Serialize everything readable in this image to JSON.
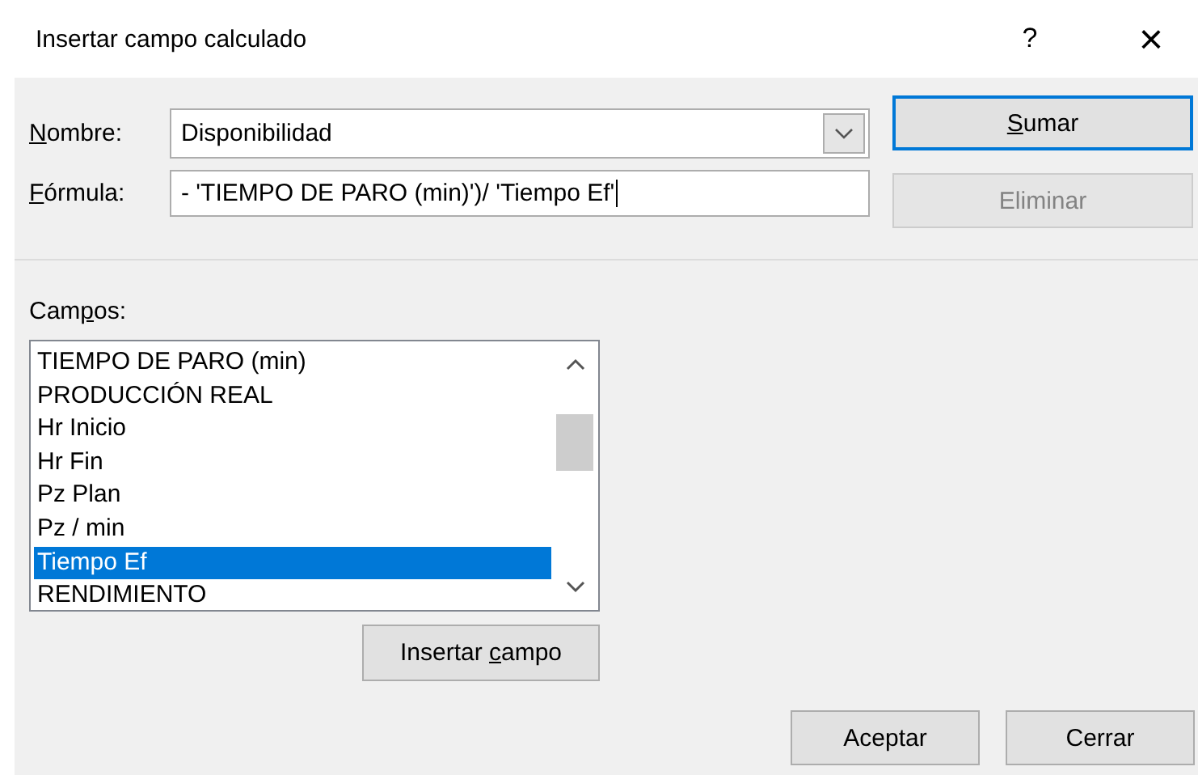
{
  "window": {
    "title": "Insertar campo calculado",
    "help": "?",
    "close": "×"
  },
  "name": {
    "label": [
      {
        "text": "N",
        "underlined": true
      },
      {
        "text": "ombre:",
        "underlined": false
      }
    ],
    "value": "Disponibilidad"
  },
  "formula": {
    "label": [
      {
        "text": "F",
        "underlined": true
      },
      {
        "text": "órmula:",
        "underlined": false
      }
    ],
    "value": "- 'TIEMPO DE PARO (min)')/ 'Tiempo Ef'"
  },
  "side_buttons": [
    {
      "label": [
        {
          "text": "S",
          "underlined": true
        },
        {
          "text": "umar",
          "underlined": false
        }
      ],
      "default": true,
      "disabled": false
    },
    {
      "label": [
        {
          "text": "Eliminar",
          "underlined": false
        }
      ],
      "disabled": true,
      "default": false
    }
  ],
  "fields": {
    "label": [
      {
        "text": "Cam",
        "underlined": false
      },
      {
        "text": "p",
        "underlined": true
      },
      {
        "text": "os:",
        "underlined": false
      }
    ],
    "items": [
      {
        "label": "TIEMPO DE PARO (min)",
        "selected": false
      },
      {
        "label": "PRODUCCIÓN REAL",
        "selected": false
      },
      {
        "label": "Hr Inicio",
        "selected": false
      },
      {
        "label": "Hr Fin",
        "selected": false
      },
      {
        "label": "Pz Plan",
        "selected": false
      },
      {
        "label": "Pz / min",
        "selected": false
      },
      {
        "label": "Tiempo Ef",
        "selected": true
      },
      {
        "label": "RENDIMIENTO",
        "selected": false
      }
    ]
  },
  "insert_button": {
    "label": [
      {
        "text": "Insertar ",
        "underlined": false
      },
      {
        "text": "c",
        "underlined": true
      },
      {
        "text": "ampo",
        "underlined": false
      }
    ]
  },
  "footer_buttons": [
    {
      "label": "Aceptar"
    },
    {
      "label": "Cerrar"
    }
  ]
}
